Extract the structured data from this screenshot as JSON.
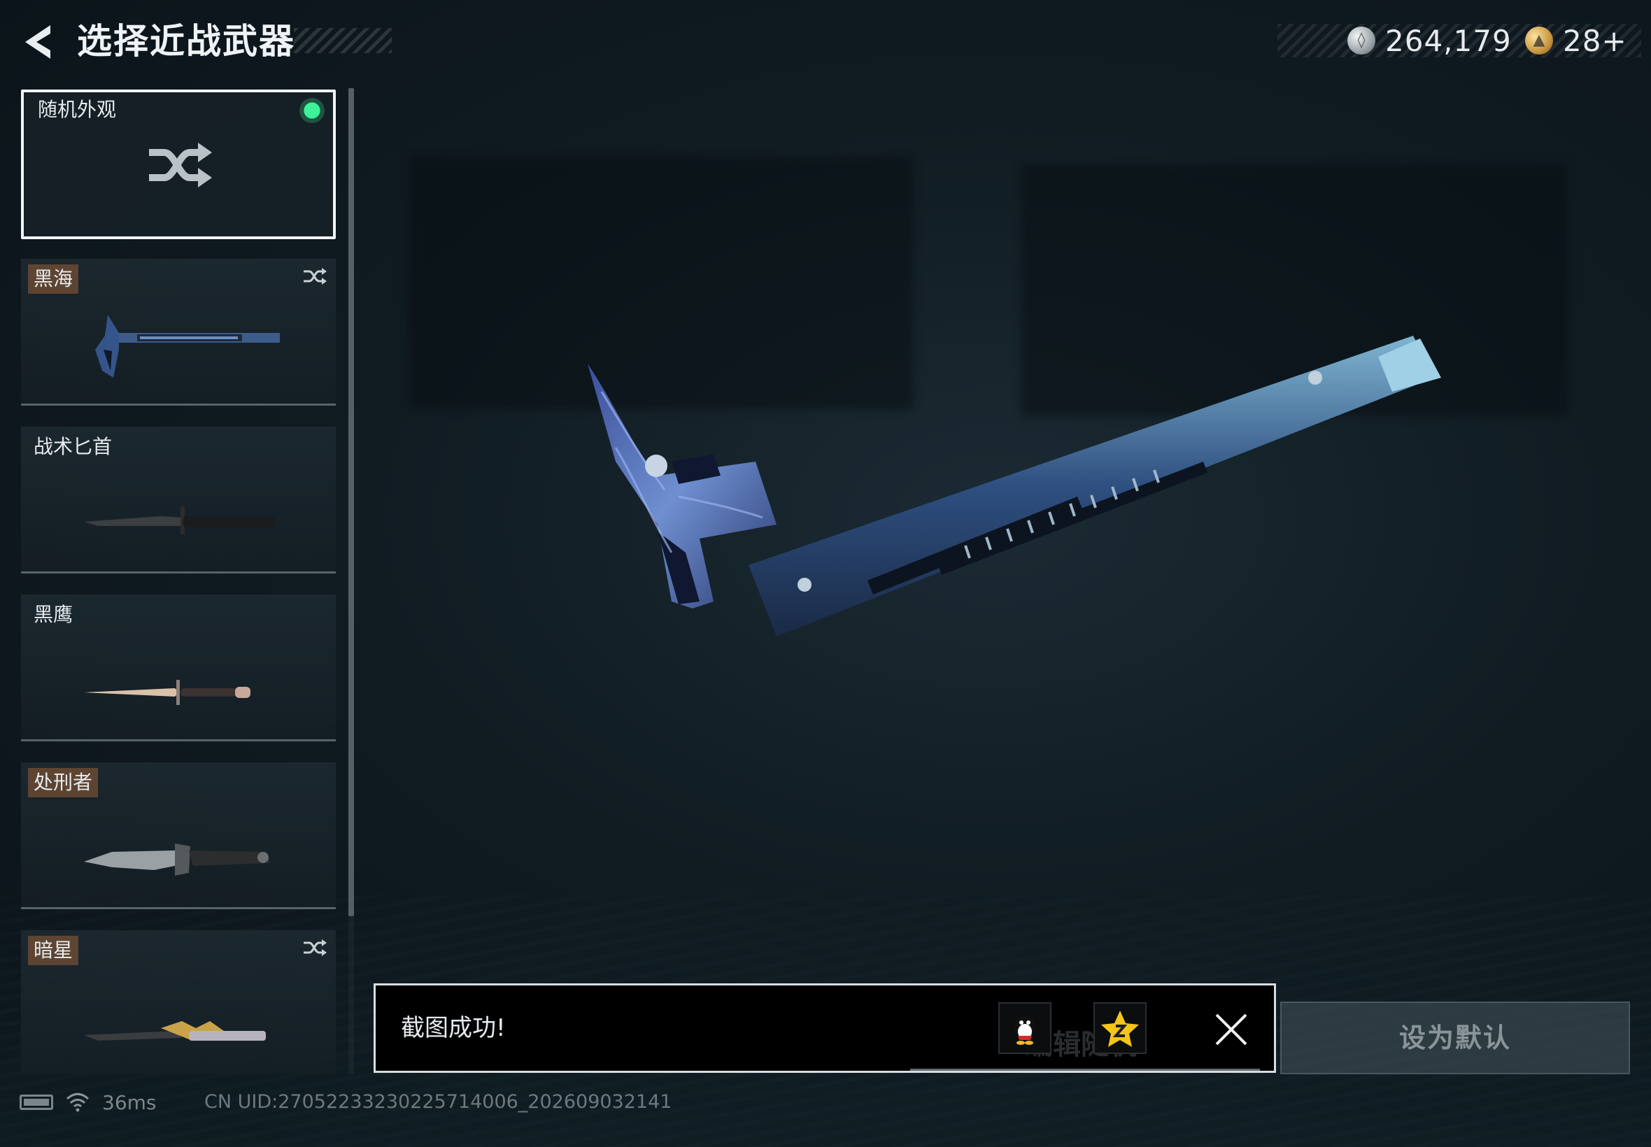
{
  "header": {
    "title": "选择近战武器",
    "currencies": [
      {
        "icon": "silver-coin-icon",
        "value": "264,179"
      },
      {
        "icon": "gold-coin-icon",
        "value": "28+"
      }
    ]
  },
  "weapon_list": [
    {
      "label": "随机外观",
      "selected": true,
      "equipped": true
    },
    {
      "label": "黑海",
      "tagged": true,
      "shuffle_icon": true
    },
    {
      "label": "战术匕首"
    },
    {
      "label": "黑鹰"
    },
    {
      "label": "处刑者",
      "tagged": true
    },
    {
      "label": "暗星",
      "tagged": true,
      "shuffle_icon": true
    }
  ],
  "toast": {
    "message": "截图成功!",
    "underlay_text": "编辑随机",
    "share_targets": [
      "qq-icon",
      "qzone-star-icon"
    ]
  },
  "actions": {
    "set_default_label": "设为默认"
  },
  "footer": {
    "ping": "36ms",
    "uid": "CN UID:27052233230225714006_202609032141"
  },
  "colors": {
    "equipped_indicator": "#3ef29a",
    "tag_background": "#965f37",
    "selected_border": "#f2f5f7"
  }
}
